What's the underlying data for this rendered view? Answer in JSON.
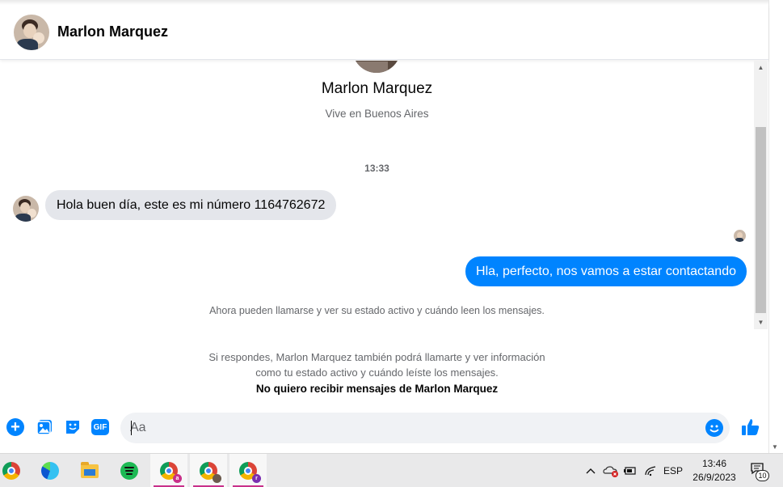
{
  "header": {
    "contact_name": "Marlon Marquez"
  },
  "profile": {
    "name": "Marlon Marquez",
    "subtitle": "Vive en Buenos Aires"
  },
  "conversation": {
    "timestamp": "13:33",
    "messages": [
      {
        "direction": "incoming",
        "text": "Hola buen día, este es mi número 1164762672"
      },
      {
        "direction": "outgoing",
        "text": "Hla, perfecto, nos vamos a estar contactando"
      }
    ],
    "info_active_status": "Ahora pueden llamarse y ver su estado activo y cuándo leen los mensajes.",
    "info_reply_line1": "Si respondes, Marlon Marquez también podrá llamarte y ver información",
    "info_reply_line2": "como tu estado activo y cuándo leíste los mensajes.",
    "block_link": "No quiero recibir mensajes de Marlon Marquez"
  },
  "composer": {
    "placeholder": "Aa",
    "icons": [
      "plus-icon",
      "photo-icon",
      "sticker-icon",
      "gif-icon",
      "emoji-icon",
      "like-icon"
    ],
    "gif_label": "GIF"
  },
  "colors": {
    "accent": "#0084ff",
    "incoming_bubble": "#e4e6eb",
    "input_bg": "#f0f2f5"
  },
  "taskbar": {
    "apps": [
      "chrome-icon",
      "edge-icon",
      "file-explorer-icon",
      "spotify-icon",
      "chrome-profile-a-icon",
      "chrome-profile-photo-icon",
      "chrome-profile-r-icon"
    ],
    "profile_badges": [
      "a",
      "",
      "r"
    ],
    "language": "ESP",
    "time": "13:46",
    "date": "26/9/2023",
    "notification_count": "10"
  }
}
